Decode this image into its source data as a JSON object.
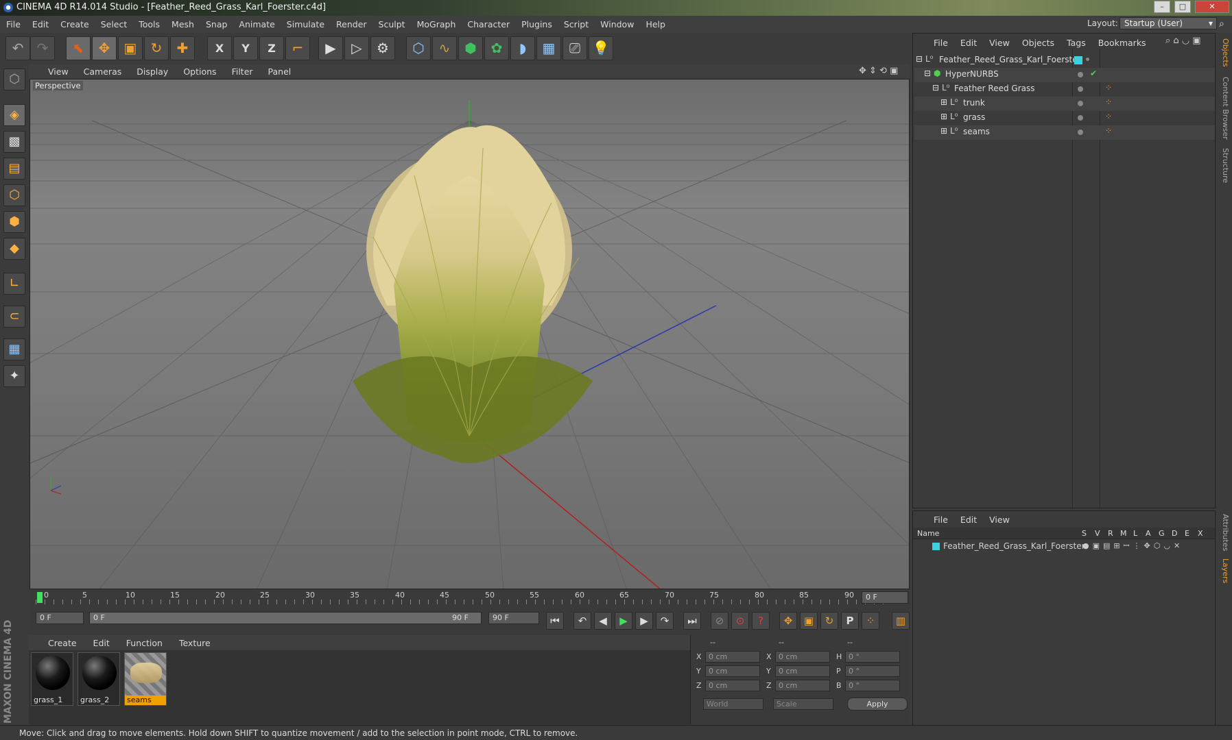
{
  "window": {
    "title": "CINEMA 4D R14.014 Studio - [Feather_Reed_Grass_Karl_Foerster.c4d]",
    "buttons": [
      "–",
      "□",
      "✕"
    ]
  },
  "menubar": {
    "items": [
      "File",
      "Edit",
      "Create",
      "Select",
      "Tools",
      "Mesh",
      "Snap",
      "Animate",
      "Simulate",
      "Render",
      "Sculpt",
      "MoGraph",
      "Character",
      "Plugins",
      "Script",
      "Window",
      "Help"
    ],
    "layout_label": "Layout:",
    "layout_value": "Startup (User)"
  },
  "toolbar": {
    "icons": [
      "undo-icon",
      "redo-icon",
      "live-selection-icon",
      "move-icon",
      "scale-icon",
      "rotate-icon",
      "add-icon",
      "x-axis-icon",
      "y-axis-icon",
      "z-axis-icon",
      "coordinate-system-icon",
      "render-view-icon",
      "render-picture-viewer-icon",
      "render-settings-icon",
      "cube-icon",
      "spline-icon",
      "nurbs-icon",
      "array-icon",
      "deformer-icon",
      "scene-floor-icon",
      "camera-icon",
      "light-icon"
    ],
    "axis_labels": [
      "X",
      "Y",
      "Z"
    ]
  },
  "left_tools": [
    "make-editable-icon",
    "model-mode-icon",
    "texture-mode-icon",
    "workplane-icon",
    "points-mode-icon",
    "edges-mode-icon",
    "polygons-mode-icon",
    "axis-mode-icon",
    "magnet-icon",
    "lock-workplane-icon",
    "snap-settings-icon"
  ],
  "viewport": {
    "menu": [
      "View",
      "Cameras",
      "Display",
      "Options",
      "Filter",
      "Panel"
    ],
    "label": "Perspective"
  },
  "timeline": {
    "ticks": [
      "0",
      "5",
      "10",
      "15",
      "20",
      "25",
      "30",
      "35",
      "40",
      "45",
      "50",
      "55",
      "60",
      "65",
      "70",
      "75",
      "80",
      "85",
      "90"
    ],
    "current_frame": "0 F",
    "start_field": "0 F",
    "range_start": "0 F",
    "range_end": "90 F",
    "end_field": "90 F"
  },
  "playback": {
    "icons": [
      "go-to-start-icon",
      "previous-key-icon",
      "previous-frame-icon",
      "play-icon",
      "next-frame-icon",
      "next-key-icon",
      "go-to-end-icon",
      "record-active-icon",
      "autokey-icon",
      "keyframe-selection-icon",
      "position-key-icon",
      "scale-key-icon",
      "rotation-key-icon",
      "parameter-key-icon",
      "pla-key-icon",
      "timeline-icon"
    ],
    "parameter_label": "P"
  },
  "materials": {
    "menu": [
      "Create",
      "Edit",
      "Function",
      "Texture"
    ],
    "items": [
      {
        "name": "grass_1"
      },
      {
        "name": "grass_2"
      },
      {
        "name": "seams",
        "selected": true
      }
    ]
  },
  "coordinates": {
    "headers": [
      "--",
      "--",
      "--"
    ],
    "rows": [
      {
        "a_lbl": "X",
        "a": "0 cm",
        "b_lbl": "X",
        "b": "0 cm",
        "c_lbl": "H",
        "c": "0 °"
      },
      {
        "a_lbl": "Y",
        "a": "0 cm",
        "b_lbl": "Y",
        "b": "0 cm",
        "c_lbl": "P",
        "c": "0 °"
      },
      {
        "a_lbl": "Z",
        "a": "0 cm",
        "b_lbl": "Z",
        "b": "0 cm",
        "c_lbl": "B",
        "c": "0 °"
      }
    ],
    "mode1": "World",
    "mode2": "Scale",
    "apply": "Apply"
  },
  "object_manager": {
    "menu": [
      "File",
      "Edit",
      "View",
      "Objects",
      "Tags",
      "Bookmarks"
    ],
    "objects": [
      {
        "name": "Feather_Reed_Grass_Karl_Foerster",
        "depth": 0,
        "toggle": "⊟"
      },
      {
        "name": "HyperNURBS",
        "depth": 1,
        "toggle": "⊟"
      },
      {
        "name": "Feather Reed Grass",
        "depth": 2,
        "toggle": "⊟"
      },
      {
        "name": "trunk",
        "depth": 3,
        "toggle": "⊞"
      },
      {
        "name": "grass",
        "depth": 3,
        "toggle": "⊞"
      },
      {
        "name": "seams",
        "depth": 3,
        "toggle": "⊞"
      }
    ]
  },
  "layer_manager": {
    "menu": [
      "File",
      "Edit",
      "View"
    ],
    "columns": [
      "Name",
      "S",
      "V",
      "R",
      "M",
      "L",
      "A",
      "G",
      "D",
      "E",
      "X"
    ],
    "layers": [
      {
        "name": "Feather_Reed_Grass_Karl_Foerster",
        "color": "#3fd0e0"
      }
    ]
  },
  "side_tabs": [
    "Objects",
    "Content Browser",
    "Structure",
    "Attributes",
    "Layers"
  ],
  "branding": "MAXON CINEMA 4D",
  "status": "Move: Click and drag to move elements. Hold down SHIFT to quantize movement / add to the selection in point mode, CTRL to remove.",
  "colors": {
    "accent": "#f0a030",
    "selected": "#f0a000",
    "layer": "#3fd0e0"
  }
}
